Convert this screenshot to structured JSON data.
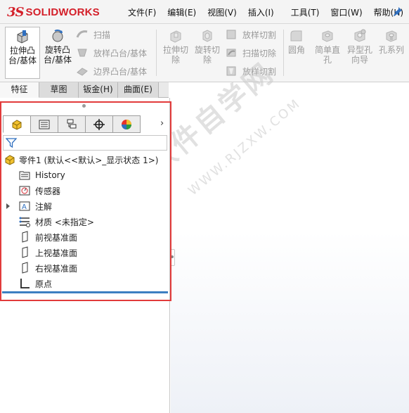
{
  "app": {
    "logo_mark": "3S",
    "logo_text": "SOLIDWORKS",
    "brand_color": "#d4202a"
  },
  "menu": {
    "items": [
      "文件(F)",
      "编辑(E)",
      "视图(V)",
      "插入(I)",
      "工具(T)",
      "窗口(W)",
      "帮助(H)"
    ]
  },
  "toolbar": {
    "extrude_boss": "拉伸凸\n台/基体",
    "revolve_boss": "旋转凸\n台/基体",
    "sweep": "扫描",
    "loft_boss": "放样凸台/基体",
    "boundary_boss": "边界凸台/基体",
    "extrude_cut": "拉伸切\n除",
    "revolve_cut": "旋转切\n除",
    "loft_cut": "放样切割",
    "sweep_cut": "扫描切除",
    "boundary_cut": "放样切割",
    "fillet": "圆角",
    "simple_hole": "简单直\n孔",
    "hole_wizard": "异型孔\n向导",
    "hole_series": "孔系列"
  },
  "tabs": [
    "特征",
    "草图",
    "钣金(H)",
    "曲面(E)"
  ],
  "feature_tree": {
    "part": "零件1 (默认<<默认>_显示状态 1>)",
    "items": [
      "History",
      "传感器",
      "注解",
      "材质 <未指定>",
      "前视基准面",
      "上视基准面",
      "右视基准面",
      "原点"
    ]
  },
  "watermark": {
    "main": "软件自学网",
    "sub": "WWW.RJZXW.COM"
  }
}
